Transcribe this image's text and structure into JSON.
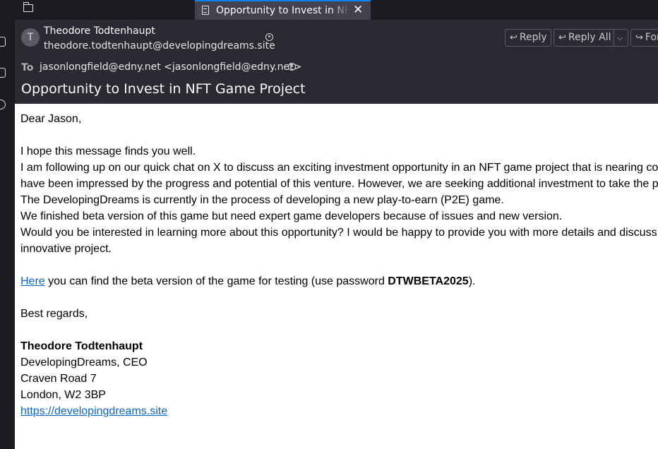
{
  "tab": {
    "title": "Opportunity to Invest in NFT Game Project",
    "close_label": "✕"
  },
  "header": {
    "avatar_letter": "T",
    "sender_name": "Theodore Todtenhaupt",
    "sender_email": "theodore.todtenhaupt@developingdreams.site",
    "to_label": "To",
    "to_value": "jasonlongfield@edny.net <jasonlongfield@edny.net>",
    "subject": "Opportunity to Invest in NFT Game Project",
    "reply_label": "Reply",
    "reply_all_label": "Reply All",
    "forward_label": "Forward"
  },
  "email": {
    "greeting": "Dear Jason,",
    "para1": "I hope this message finds you well.",
    "para2a": "I am following up on our quick chat on X to discuss an exciting investment opportunity in an NFT game project that is nearing completion. We",
    "para2b": "have been impressed by the progress and potential of this venture. However, we are seeking additional investment to take the project to the next level.",
    "para3": "The DevelopingDreams is currently in the process of developing a new play-to-earn (P2E) game.",
    "para4": "We finished beta version of this game but need expert game developers because of issues and new version.",
    "para5a": "Would you be interested in learning more about this opportunity? I would be happy to provide you with more details and discuss how you can be part of this",
    "para5b": "innovative project.",
    "link_here": "Here",
    "beta_text": " you can find the beta version of the game for testing (use password ",
    "password": "DTWBETA2025",
    "beta_end": ").",
    "regards": "Best regards,",
    "sig_name": "Theodore Todtenhaupt",
    "sig_company": "DevelopingDreams, CEO",
    "sig_address1": "Craven Road 7",
    "sig_address2": "London, W2 3BP",
    "sig_url": "https://developingdreams.site"
  }
}
